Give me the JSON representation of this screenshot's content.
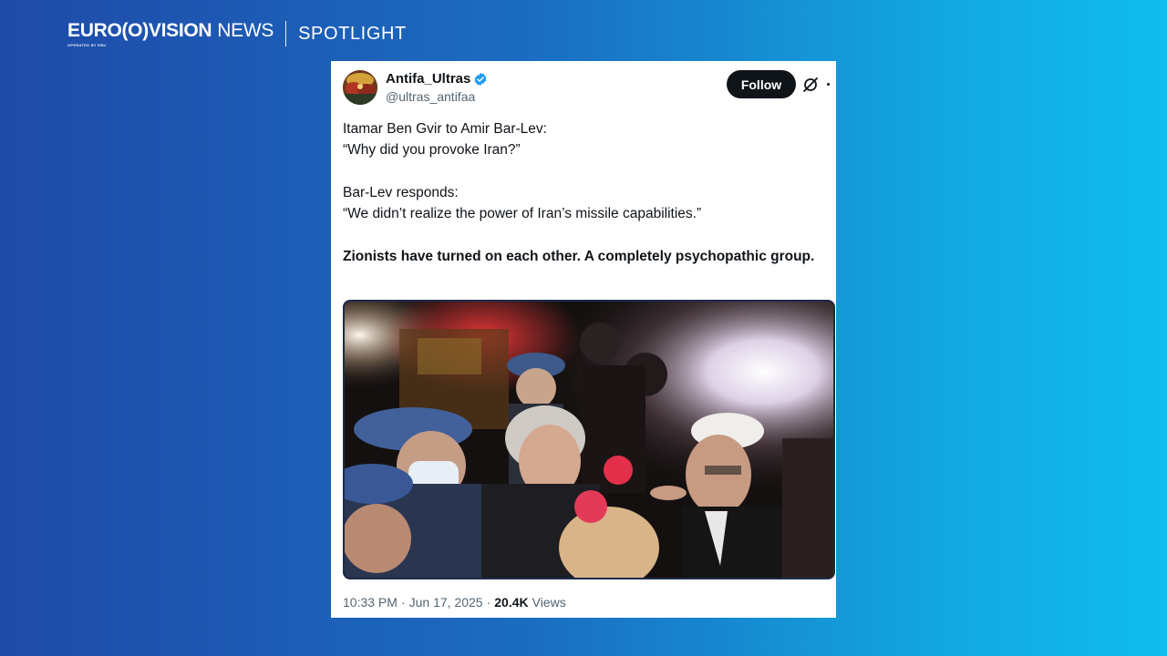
{
  "brand": {
    "logo_bold": "EURO(O)VISION",
    "logo_light": "NEWS",
    "logo_sub": "OPERATED BY EBU",
    "section": "SPOTLIGHT"
  },
  "tweet": {
    "display_name": "Antifa_Ultras",
    "handle": "@ultras_antifaa",
    "follow_label": "Follow",
    "lines": [
      "Itamar Ben Gvir to Amir Bar-Lev:",
      "“Why did you provoke Iran?”",
      "Bar-Lev responds:",
      "“We didn’t realize the power of Iran’s missile capabilities.”",
      "Zionists have turned on each other. A completely psychopathic group."
    ],
    "time": "10:33 PM",
    "separator": "·",
    "date": "Jun 17, 2025",
    "views_count": "20.4K",
    "views_label": "Views"
  },
  "icons": {
    "verified": "verified-badge-icon",
    "x_logo": "x-logo-icon",
    "more": "more-icon"
  },
  "colors": {
    "verified_blue": "#1d9bf0",
    "follow_bg": "#0f1419"
  }
}
